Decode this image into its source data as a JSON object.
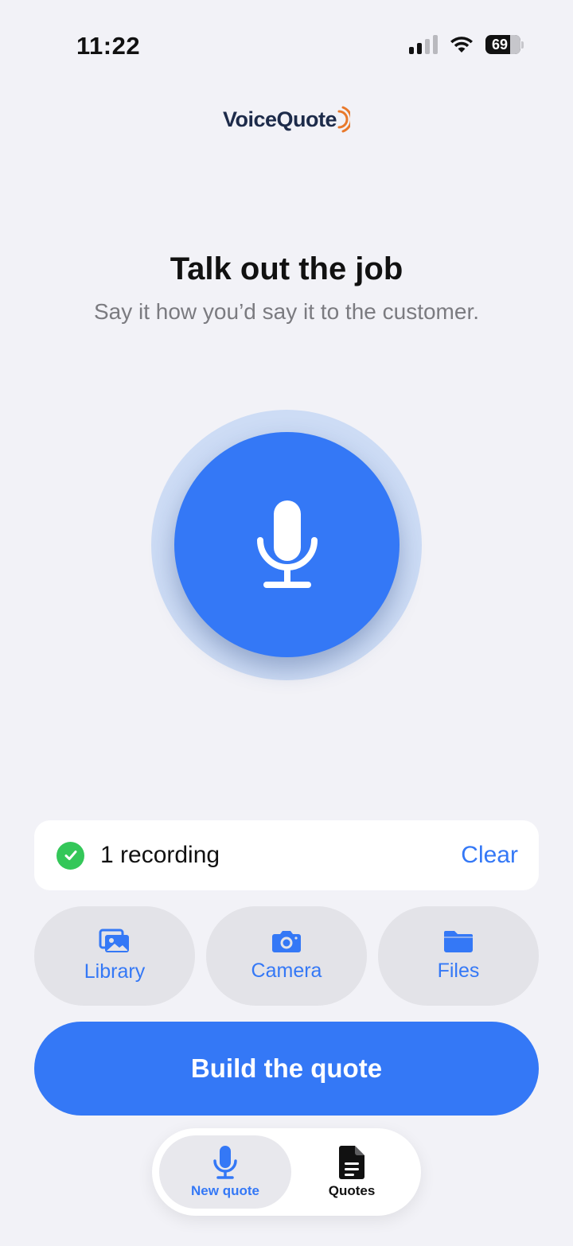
{
  "status_bar": {
    "time": "11:22",
    "battery": "69"
  },
  "logo": {
    "text": "VoiceQuote"
  },
  "header": {
    "title": "Talk out the job",
    "subtitle": "Say it how you’d say it to the customer."
  },
  "recording": {
    "label": "1 recording",
    "clear_label": "Clear"
  },
  "attachments": {
    "library_label": "Library",
    "camera_label": "Camera",
    "files_label": "Files"
  },
  "build_button": {
    "label": "Build the quote"
  },
  "tabs": [
    {
      "label": "New quote",
      "icon": "microphone-icon"
    },
    {
      "label": "Quotes",
      "icon": "document-icon"
    }
  ],
  "colors": {
    "accent": "#3478f6",
    "background": "#f2f2f7",
    "success": "#34c759",
    "logo_wave": "#e8792b"
  }
}
